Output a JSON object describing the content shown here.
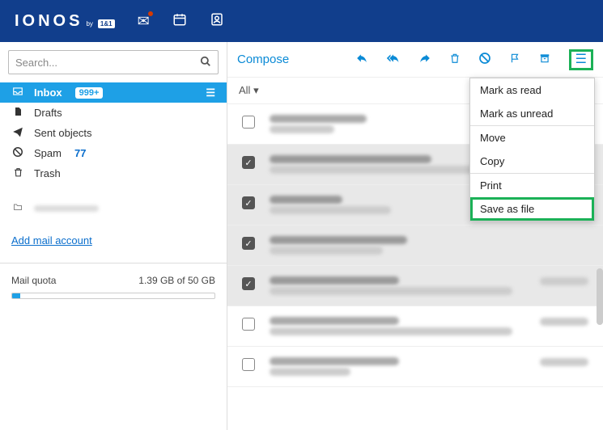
{
  "brand": {
    "name": "IONOS",
    "by": "by",
    "sub": "1&1"
  },
  "search": {
    "placeholder": "Search..."
  },
  "folders": {
    "inbox": {
      "label": "Inbox",
      "badge": "999+"
    },
    "drafts": {
      "label": "Drafts"
    },
    "sent": {
      "label": "Sent objects"
    },
    "spam": {
      "label": "Spam",
      "count": "77"
    },
    "trash": {
      "label": "Trash"
    }
  },
  "add_account": "Add mail account",
  "quota": {
    "label": "Mail quota",
    "value": "1.39 GB of 50 GB"
  },
  "toolbar": {
    "compose": "Compose"
  },
  "all_label": "All",
  "menu": {
    "read": "Mark as read",
    "unread": "Mark as unread",
    "move": "Move",
    "copy": "Copy",
    "print": "Print",
    "save": "Save as file"
  }
}
